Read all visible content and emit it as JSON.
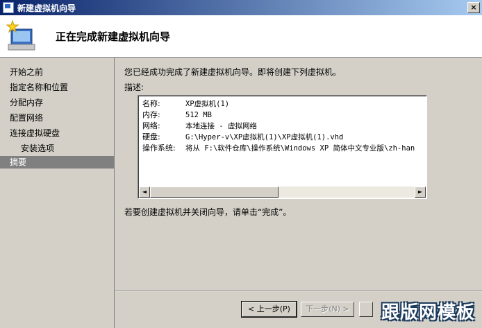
{
  "window": {
    "title": "新建虚拟机向导",
    "close_label": "×"
  },
  "header": {
    "title": "正在完成新建虚拟机向导"
  },
  "sidebar": {
    "items": [
      {
        "label": "开始之前"
      },
      {
        "label": "指定名称和位置"
      },
      {
        "label": "分配内存"
      },
      {
        "label": "配置网络"
      },
      {
        "label": "连接虚拟硬盘"
      },
      {
        "label": "安装选项"
      },
      {
        "label": "摘要"
      }
    ],
    "active": "摘要"
  },
  "main": {
    "intro": "您已经成功完成了新建虚拟机向导。即将创建下列虚拟机。",
    "desc_label": "描述:",
    "rows": [
      {
        "key": "名称:",
        "value": "XP虚拟机(1)"
      },
      {
        "key": "内存:",
        "value": "512 MB"
      },
      {
        "key": "网络:",
        "value": "本地连接 - 虚拟网络"
      },
      {
        "key": "硬盘:",
        "value": "G:\\Hyper-v\\XP虚拟机(1)\\XP虚拟机(1).vhd"
      },
      {
        "key": "操作系统:",
        "value": "将从 F:\\软件仓库\\操作系统\\Windows XP 简体中文专业版\\zh-han"
      }
    ],
    "scroll_left": "◄",
    "scroll_right": "►",
    "finish_text": "若要创建虚拟机并关闭向导，请单击“完成”。"
  },
  "buttons": {
    "back": "< 上一步(P)",
    "next": "下一步(N) >",
    "finish": ""
  },
  "watermark": "跟版网模板",
  "icons": {
    "title_icon": "wizard-window-icon",
    "header_icon": "new-vm-sparkle-icon"
  }
}
